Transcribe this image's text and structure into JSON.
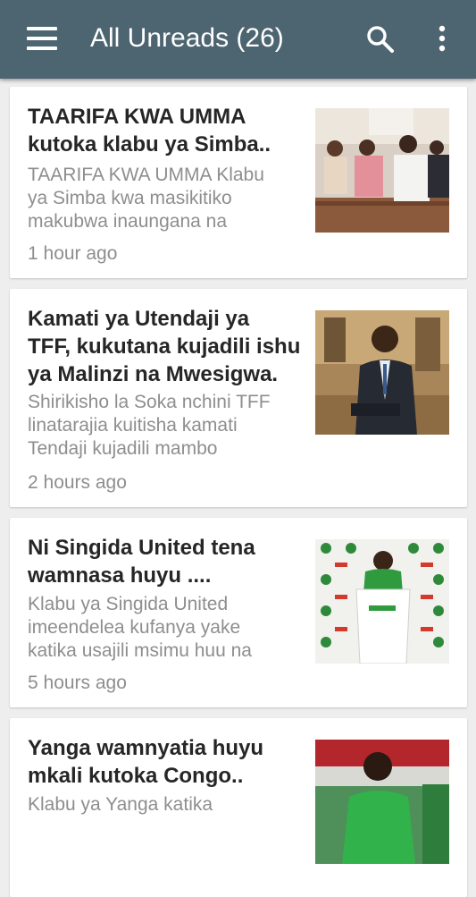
{
  "app_bar": {
    "title": "All Unreads (26)",
    "menu_icon": "hamburger-menu-icon",
    "search_icon": "search-icon",
    "overflow_icon": "more-vertical-icon",
    "background_color": "#4d6471"
  },
  "articles": [
    {
      "headline": "TAARIFA KWA UMMA\nkutoka klabu ya Simba..",
      "snippet": "TAARIFA KWA UMMA Klabu\nya Simba kwa masikitiko\nmakubwa inaungana na",
      "time": "1 hour ago"
    },
    {
      "headline": "Kamati ya Utendaji ya\nTFF, kukutana kujadili ishu\nya Malinzi na Mwesigwa.",
      "snippet": "Shirikisho la Soka nchini TFF\nlinatarajia kuitisha kamati\nTendaji kujadili mambo",
      "time": "2 hours ago"
    },
    {
      "headline": "Ni Singida United tena\nwamnasa huyu ....",
      "snippet": "Klabu ya Singida United\nimeendelea kufanya yake\nkatika usajili msimu huu na",
      "time": "5 hours ago"
    },
    {
      "headline": "Yanga wamnyatia huyu\nmkali kutoka Congo..",
      "snippet": "Klabu ya Yanga katika",
      "time": ""
    }
  ]
}
